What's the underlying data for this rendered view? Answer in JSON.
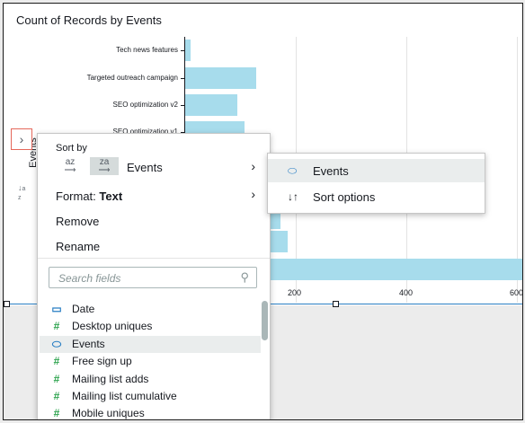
{
  "chart": {
    "title": "Count of Records by Events",
    "y_axis_title": "Events",
    "categories": [
      "Tech news features",
      "Targeted outreach campaign",
      "SEO optimization v2",
      "SEO optimization v1"
    ],
    "x_ticks": [
      "200",
      "400",
      "600"
    ]
  },
  "chart_data": {
    "type": "bar",
    "orientation": "horizontal",
    "title": "Count of Records by Events",
    "ylabel": "Events",
    "categories": [
      "Tech news features",
      "Targeted outreach campaign",
      "SEO optimization v2",
      "SEO optimization v1"
    ],
    "values": [
      10,
      128,
      95,
      108
    ],
    "hidden_bars_visible_values": [
      172,
      185,
      620
    ],
    "xlim": [
      0,
      620
    ],
    "x_ticks": [
      200,
      400,
      600
    ],
    "grid": true
  },
  "menu": {
    "sort_by_label": "Sort by",
    "sort_asc_label": "az",
    "sort_desc_label": "za",
    "sort_field": "Events",
    "format_label": "Format:",
    "format_value": "Text",
    "remove_label": "Remove",
    "rename_label": "Rename",
    "search_placeholder": "Search fields",
    "fields": [
      {
        "label": "Date",
        "icon": "calendar-icon"
      },
      {
        "label": "Desktop uniques",
        "icon": "hash-icon"
      },
      {
        "label": "Events",
        "icon": "dimension-tag-icon"
      },
      {
        "label": "Free sign up",
        "icon": "hash-icon"
      },
      {
        "label": "Mailing list adds",
        "icon": "hash-icon"
      },
      {
        "label": "Mailing list cumulative",
        "icon": "hash-icon"
      },
      {
        "label": "Mobile uniques",
        "icon": "hash-icon"
      }
    ]
  },
  "submenu": {
    "items": [
      {
        "label": "Events",
        "icon": "dimension-tag-icon"
      },
      {
        "label": "Sort options",
        "icon": "sort-options-icon"
      }
    ]
  },
  "colors": {
    "bar": "#a7dcec",
    "accent": "#2a7fc4",
    "measure_icon": "#2ea44f",
    "highlight_border": "#e5685b"
  }
}
